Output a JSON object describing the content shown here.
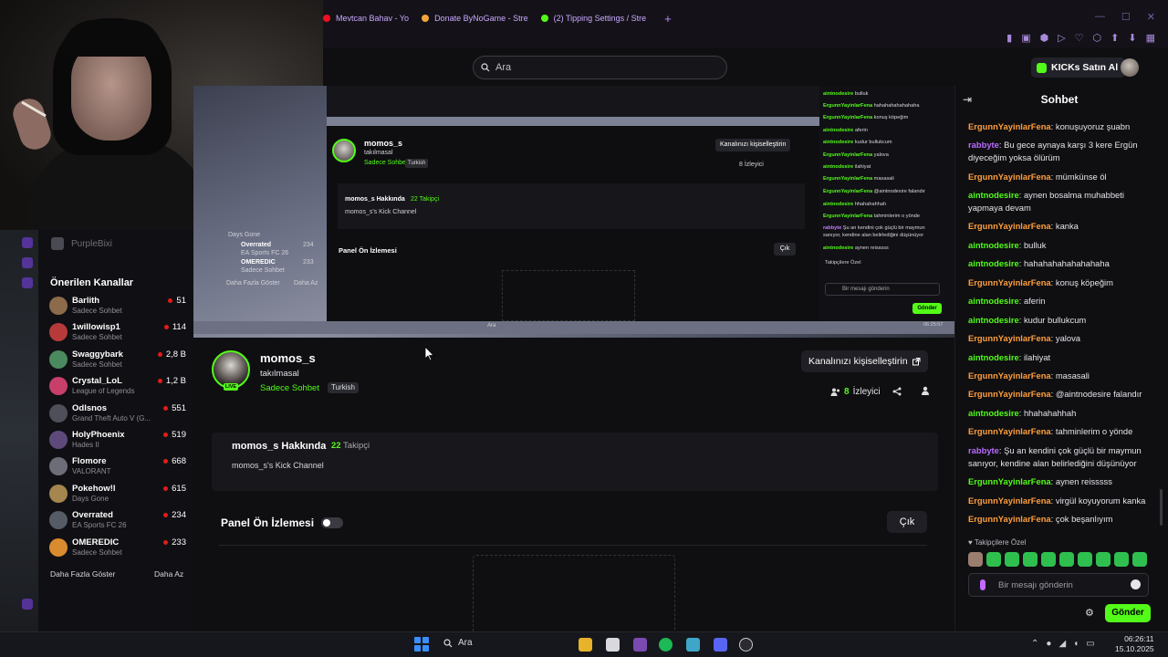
{
  "browser": {
    "tabs": [
      {
        "label": "Mevtcan Bahav - Yo"
      },
      {
        "label": "Donate ByNoGame - Stre"
      },
      {
        "label": "(2) Tipping Settings / Stre"
      }
    ],
    "new_tab": "+",
    "window_controls": [
      "—",
      "☐",
      "✕"
    ],
    "toolbar_icons": [
      "▮",
      "▣",
      "⬢",
      "▷",
      "♡",
      "⬡",
      "⬆",
      "⬇",
      "▦"
    ]
  },
  "header": {
    "search_placeholder": "Ara",
    "buy_label": "KICKs Satın Al"
  },
  "sidebar": {
    "top_channel": "PurpleBixi",
    "title": "Önerilen Kanallar",
    "channels": [
      {
        "name": "Barlith",
        "category": "Sadece Sohbet",
        "viewers": "51"
      },
      {
        "name": "1willowisp1",
        "category": "Sadece Sohbet",
        "viewers": "114"
      },
      {
        "name": "Swaggybark",
        "category": "Sadece Sohbet",
        "viewers": "2,8 B"
      },
      {
        "name": "Crystal_LoL",
        "category": "League of Legends",
        "viewers": "1,2 B"
      },
      {
        "name": "Odlsnos",
        "category": "Grand Theft Auto V (G...",
        "viewers": "551"
      },
      {
        "name": "HolyPhoenix",
        "category": "Hades II",
        "viewers": "519"
      },
      {
        "name": "Flomore",
        "category": "VALORANT",
        "viewers": "668"
      },
      {
        "name": "Pokehow!l",
        "category": "Days Gone",
        "viewers": "615"
      },
      {
        "name": "Overrated",
        "category": "EA Sports FC 26",
        "viewers": "234"
      },
      {
        "name": "OMEREDIC",
        "category": "Sadece Sohbet",
        "viewers": "233"
      }
    ],
    "show_more": "Daha Fazla Göster",
    "show_less": "Daha Az"
  },
  "preview": {
    "name": "momos_s",
    "title": "takılmasal",
    "category": "Sadece Sohbet",
    "lang": "Turkish",
    "customize": "Kanalınızı kişiselleştirin",
    "viewers": "8 İzleyici",
    "about_title": "momos_s Hakkında",
    "followers": "22 Takipçi",
    "about_desc": "momos_s's Kick Channel",
    "panel": "Panel Ön İzlemesi",
    "exit": "Çık",
    "sidebar_rows": [
      {
        "name": "Days Gone",
        "count": ""
      },
      {
        "name": "Overrated",
        "count": "234"
      },
      {
        "name": "EA Sports FC 26",
        "count": ""
      },
      {
        "name": "OMEREDIC",
        "count": "233"
      },
      {
        "name": "Sadece Sohbet",
        "count": ""
      },
      {
        "name": "Daha Fazla Göster",
        "count": "Daha Az"
      }
    ],
    "chat": [
      {
        "u": "aintnodesire",
        "m": "bulluk",
        "c": "g"
      },
      {
        "u": "ErgunnYayinlarFena",
        "m": "hahahahahahahaha",
        "c": "g"
      },
      {
        "u": "ErgunnYayinlarFena",
        "m": "konuş köpeğim",
        "c": "g"
      },
      {
        "u": "aintnodesire",
        "m": "aferin",
        "c": "g"
      },
      {
        "u": "aintnodesire",
        "m": "kudur bullukcum",
        "c": "g"
      },
      {
        "u": "ErgunnYayinlarFena",
        "m": "yalova",
        "c": "g"
      },
      {
        "u": "aintnodesire",
        "m": "ilahiyat",
        "c": "g"
      },
      {
        "u": "ErgunnYayinlarFena",
        "m": "masasali",
        "c": "g"
      },
      {
        "u": "ErgunnYayinlarFena",
        "m": "@aintnodesire falandır",
        "c": "g"
      },
      {
        "u": "aintnodesire",
        "m": "hhahahahhah",
        "c": "g"
      },
      {
        "u": "ErgunnYayinlarFena",
        "m": "tahminlerim o yönde",
        "c": "g"
      },
      {
        "u": "rabbyte",
        "m": "Şu an kendini çok güçlü bir maymun",
        "c": "p"
      },
      {
        "u": "",
        "m": "sanıyor, kendine alan belirlediğini düşünüyor",
        "c": "g"
      },
      {
        "u": "aintnodesire",
        "m": "aynen reisssss",
        "c": "g"
      }
    ],
    "sub_label": "Takipçilere Özel",
    "input_ph": "Bir mesajı gönderin",
    "send": "Gönder",
    "taskbar_search": "Ara",
    "clock": "06:25:57"
  },
  "channel": {
    "name": "momos_s",
    "title": "takılmasal",
    "category": "Sadece Sohbet",
    "language": "Turkish",
    "live_badge": "LIVE",
    "customize_label": "Kanalınızı kişiselleştirin",
    "viewer_count": "8",
    "viewer_label": "İzleyici"
  },
  "about": {
    "title": "momos_s Hakkında",
    "follower_count": "22",
    "follower_label": "Takipçi",
    "description": "momos_s's Kick Channel"
  },
  "panel": {
    "title": "Panel Ön İzlemesi",
    "exit_label": "Çık"
  },
  "chat": {
    "title": "Sohbet",
    "messages": [
      {
        "user": "ErgunnYayinlarFena",
        "text": "konuşuyoruz şuabn",
        "color": "o"
      },
      {
        "user": "rabbyte",
        "text": "Bu gece aynaya karşı 3 kere Ergün diyeceğim yoksa ölürüm",
        "color": "p"
      },
      {
        "user": "ErgunnYayinlarFena",
        "text": "mümkünse öl",
        "color": "o"
      },
      {
        "user": "aintnodesire",
        "text": "aynen bosalma muhabbeti yapmaya devam",
        "color": "g"
      },
      {
        "user": "ErgunnYayinlarFena",
        "text": "kanka",
        "color": "o"
      },
      {
        "user": "aintnodesire",
        "text": "bulluk",
        "color": "g"
      },
      {
        "user": "aintnodesire",
        "text": "hahahahahahahahaha",
        "color": "g"
      },
      {
        "user": "ErgunnYayinlarFena",
        "text": "konuş köpeğim",
        "color": "o"
      },
      {
        "user": "aintnodesire",
        "text": "aferin",
        "color": "g"
      },
      {
        "user": "aintnodesire",
        "text": "kudur bullukcum",
        "color": "g"
      },
      {
        "user": "ErgunnYayinlarFena",
        "text": "yalova",
        "color": "o"
      },
      {
        "user": "aintnodesire",
        "text": "ilahiyat",
        "color": "g"
      },
      {
        "user": "ErgunnYayinlarFena",
        "text": "masasali",
        "color": "o"
      },
      {
        "user": "ErgunnYayinlarFena",
        "text": "@aintnodesire falandır",
        "color": "o"
      },
      {
        "user": "aintnodesire",
        "text": "hhahahahhah",
        "color": "g"
      },
      {
        "user": "ErgunnYayinlarFena",
        "text": "tahminlerim o yönde",
        "color": "o"
      },
      {
        "user": "rabbyte",
        "text": "Şu an kendini çok güçlü bir maymun sanıyor, kendine alan belirlediğini düşünüyor",
        "color": "p"
      },
      {
        "user": "ErgunnYayinlarFena",
        "text": "aynen reisssss",
        "color": "g"
      },
      {
        "user": "ErgunnYayinlarFena",
        "text": "virgül koyuyorum kanka",
        "color": "o"
      },
      {
        "user": "ErgunnYayinlarFena",
        "text": "çok beşanlıyım",
        "color": "o"
      }
    ],
    "sub_label": "♥ Takipçilere Özel",
    "input_placeholder": "Bir mesajı gönderin",
    "send_label": "Gönder"
  },
  "taskbar": {
    "search_label": "Ara",
    "time": "06:26:11",
    "date": "15.10.2025"
  },
  "colors": {
    "kick_green": "#53fc18",
    "user_orange": "#ff9e3d",
    "user_purple": "#b86bff",
    "background": "#0f0f12"
  }
}
